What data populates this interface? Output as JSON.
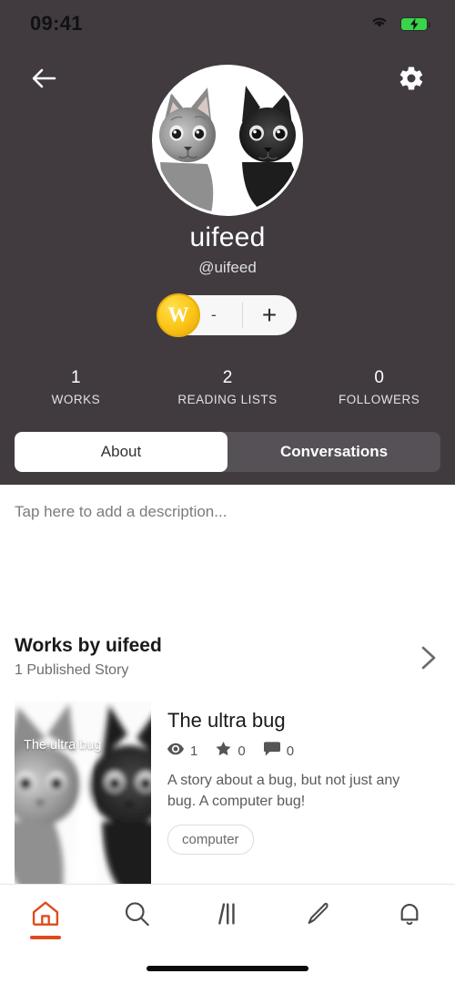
{
  "status_bar": {
    "time": "09:41",
    "wifi_icon": "wifi-icon",
    "battery_icon": "battery-charging-icon",
    "battery_color": "#3ad34a"
  },
  "header": {
    "background_color": "#413B40",
    "back_icon": "back-arrow-icon",
    "settings_icon": "gear-icon",
    "avatar": {
      "icon": "avatar-photo",
      "description": "Two black and white kittens"
    },
    "display_name": "uifeed",
    "handle": "@uifeed",
    "coin_pill": {
      "coin_icon": "wattpad-coin-icon",
      "coin_letter": "W",
      "coin_color": "#fbc417",
      "value": "-",
      "add_label": "+"
    },
    "stats": [
      {
        "value": "1",
        "label": "WORKS"
      },
      {
        "value": "2",
        "label": "READING LISTS"
      },
      {
        "value": "0",
        "label": "FOLLOWERS"
      }
    ],
    "tabs": [
      {
        "label": "About",
        "active": true
      },
      {
        "label": "Conversations",
        "active": false
      }
    ]
  },
  "main": {
    "description_placeholder": "Tap here to add a description...",
    "works_section": {
      "title": "Works by uifeed",
      "subtitle": "1 Published Story",
      "chevron_icon": "chevron-right-icon"
    },
    "story": {
      "cover_title": "The ultra bug",
      "cover_icon": "story-cover-image",
      "title": "The ultra bug",
      "metrics": [
        {
          "icon": "eye-icon",
          "value": "1"
        },
        {
          "icon": "star-icon",
          "value": "0"
        },
        {
          "icon": "comment-icon",
          "value": "0"
        }
      ],
      "description": "A story about a bug, but not just any bug. A computer bug!",
      "tags": [
        "computer"
      ]
    }
  },
  "bottom_nav": {
    "accent_color": "#DD4B1C",
    "items": [
      {
        "icon": "home-icon",
        "name": "home",
        "active": true
      },
      {
        "icon": "search-icon",
        "name": "search",
        "active": false
      },
      {
        "icon": "library-icon",
        "name": "library",
        "active": false
      },
      {
        "icon": "pencil-icon",
        "name": "write",
        "active": false
      },
      {
        "icon": "bell-icon",
        "name": "notifications",
        "active": false
      }
    ]
  }
}
